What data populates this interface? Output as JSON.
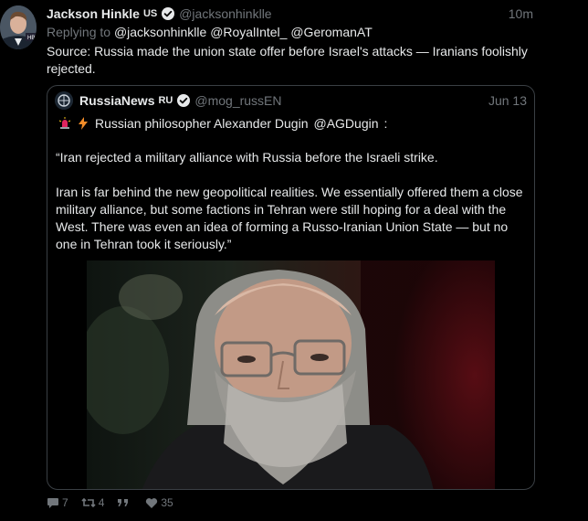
{
  "tweet": {
    "author_name": "Jackson Hinkle",
    "author_flag": "US",
    "author_handle": "@jacksonhinklle",
    "time": "10m",
    "replying_prefix": "Replying to",
    "replying_mentions": "@jacksonhinklle @RoyalIntel_ @GeromanAT",
    "text": "Source: Russia made the union state offer before Israel's attacks — Iranians foolishly rejected."
  },
  "quote": {
    "author_name": "RussiaNews",
    "author_flag": "RU",
    "author_handle": "@mog_russEN",
    "time": "Jun 13",
    "line1_text": "Russian philosopher Alexander Dugin",
    "line1_mention": "@AGDugin",
    "line1_suffix": ":",
    "para1": "“Iran rejected a military alliance with Russia before the Israeli strike.",
    "para2": "Iran is far behind the new geopolitical realities. We essentially offered them a close military alliance, but some factions in Tehran were still hoping for a deal with the West. There was even an idea of forming a Russo-Iranian Union State — but no one in Tehran took it seriously.”"
  },
  "actions": {
    "replies": "7",
    "retweets": "4",
    "quotes": "",
    "likes": "35"
  },
  "colors": {
    "background": "#000000",
    "text": "#e7e9ea",
    "muted": "#71767b",
    "border": "#3a3f44",
    "verified": "#e7e9ea"
  },
  "icons": [
    "avatar-jackson",
    "verified-icon",
    "avatar-russianews",
    "siren-icon",
    "lightning-icon",
    "reply-icon",
    "retweet-icon",
    "quote-icon",
    "heart-icon"
  ]
}
